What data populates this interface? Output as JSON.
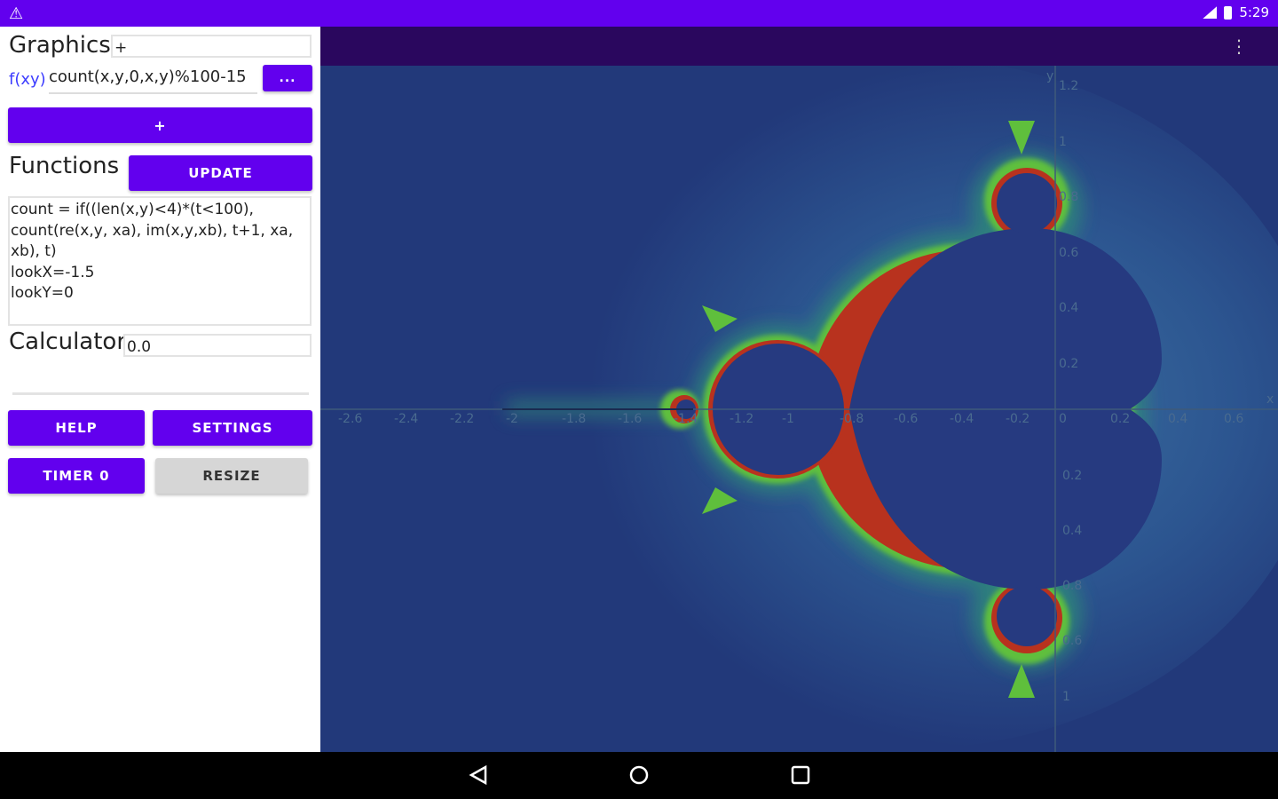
{
  "status_bar": {
    "warning_icon": "warning-icon",
    "time": "5:29"
  },
  "graphics": {
    "label": "Graphics",
    "input_value": "+"
  },
  "function_row": {
    "label": "f(xy)",
    "value": "count(x,y,0,x,y)%100-15",
    "ellipsis_button": "..."
  },
  "plus_button": "+",
  "functions": {
    "label": "Functions",
    "update_button": "UPDATE",
    "code": "count = if((len(x,y)<4)*(t<100),\ncount(re(x,y, xa), im(x,y,xb), t+1, xa,\nxb), t)\nlookX=-1.5\nlookY=0"
  },
  "calculator": {
    "label": "Calculator",
    "value": "0.0"
  },
  "buttons": {
    "help": "HELP",
    "settings": "SETTINGS",
    "timer": "TIMER 0",
    "resize": "RESIZE"
  },
  "plot": {
    "x_axis_label": "x",
    "y_axis_label": "y",
    "x_ticks": [
      "-2.6",
      "-2.4",
      "-2.2",
      "-2",
      "-1.8",
      "-1.6",
      "-1.4",
      "-1.2",
      "-1",
      "-0.8",
      "-0.6",
      "-0.4",
      "-0.2",
      "0",
      "0.2",
      "0.4",
      "0.6"
    ],
    "y_ticks": [
      "1.2",
      "1",
      "0.8",
      "0.6",
      "0.4",
      "0.2",
      "0.2",
      "0.4",
      "0.6",
      "0.8",
      "1"
    ],
    "colors": {
      "background": "#22397a",
      "set_interior": "#263a80",
      "boundary_red": "#b8321e",
      "boundary_green": "#5fbf3c"
    }
  },
  "nav": {
    "back": "back-icon",
    "home": "home-icon",
    "recents": "recents-icon"
  }
}
